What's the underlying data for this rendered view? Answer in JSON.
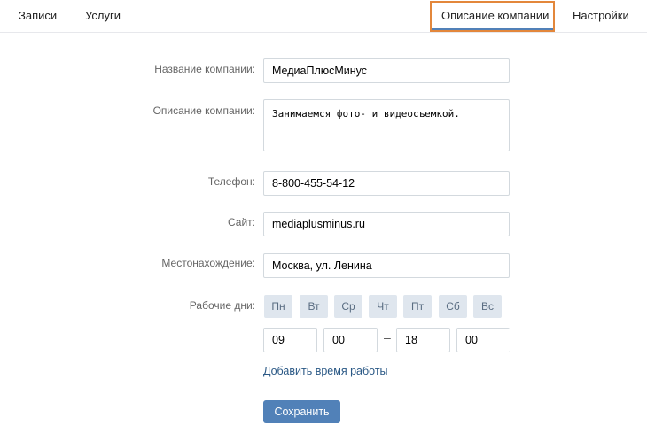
{
  "tabs": {
    "records": "Записи",
    "services": "Услуги",
    "company_description": "Описание компании",
    "settings": "Настройки"
  },
  "form": {
    "name_label": "Название компании:",
    "name_value": "МедиаПлюсМинус",
    "description_label": "Описание компании:",
    "description_value": "Занимаемся фото- и видеосъемкой.",
    "phone_label": "Телефон:",
    "phone_value": "8-800-455-54-12",
    "site_label": "Сайт:",
    "site_value": "mediaplusminus.ru",
    "location_label": "Местонахождение:",
    "location_value": "Москва, ул. Ленина",
    "workdays_label": "Рабочие дни:",
    "days": [
      "Пн",
      "Вт",
      "Ср",
      "Чт",
      "Пт",
      "Сб",
      "Вс"
    ],
    "time": {
      "from_hour": "09",
      "from_minute": "00",
      "to_hour": "18",
      "to_minute": "00"
    },
    "add_time_link": "Добавить время работы",
    "save_button": "Сохранить"
  }
}
